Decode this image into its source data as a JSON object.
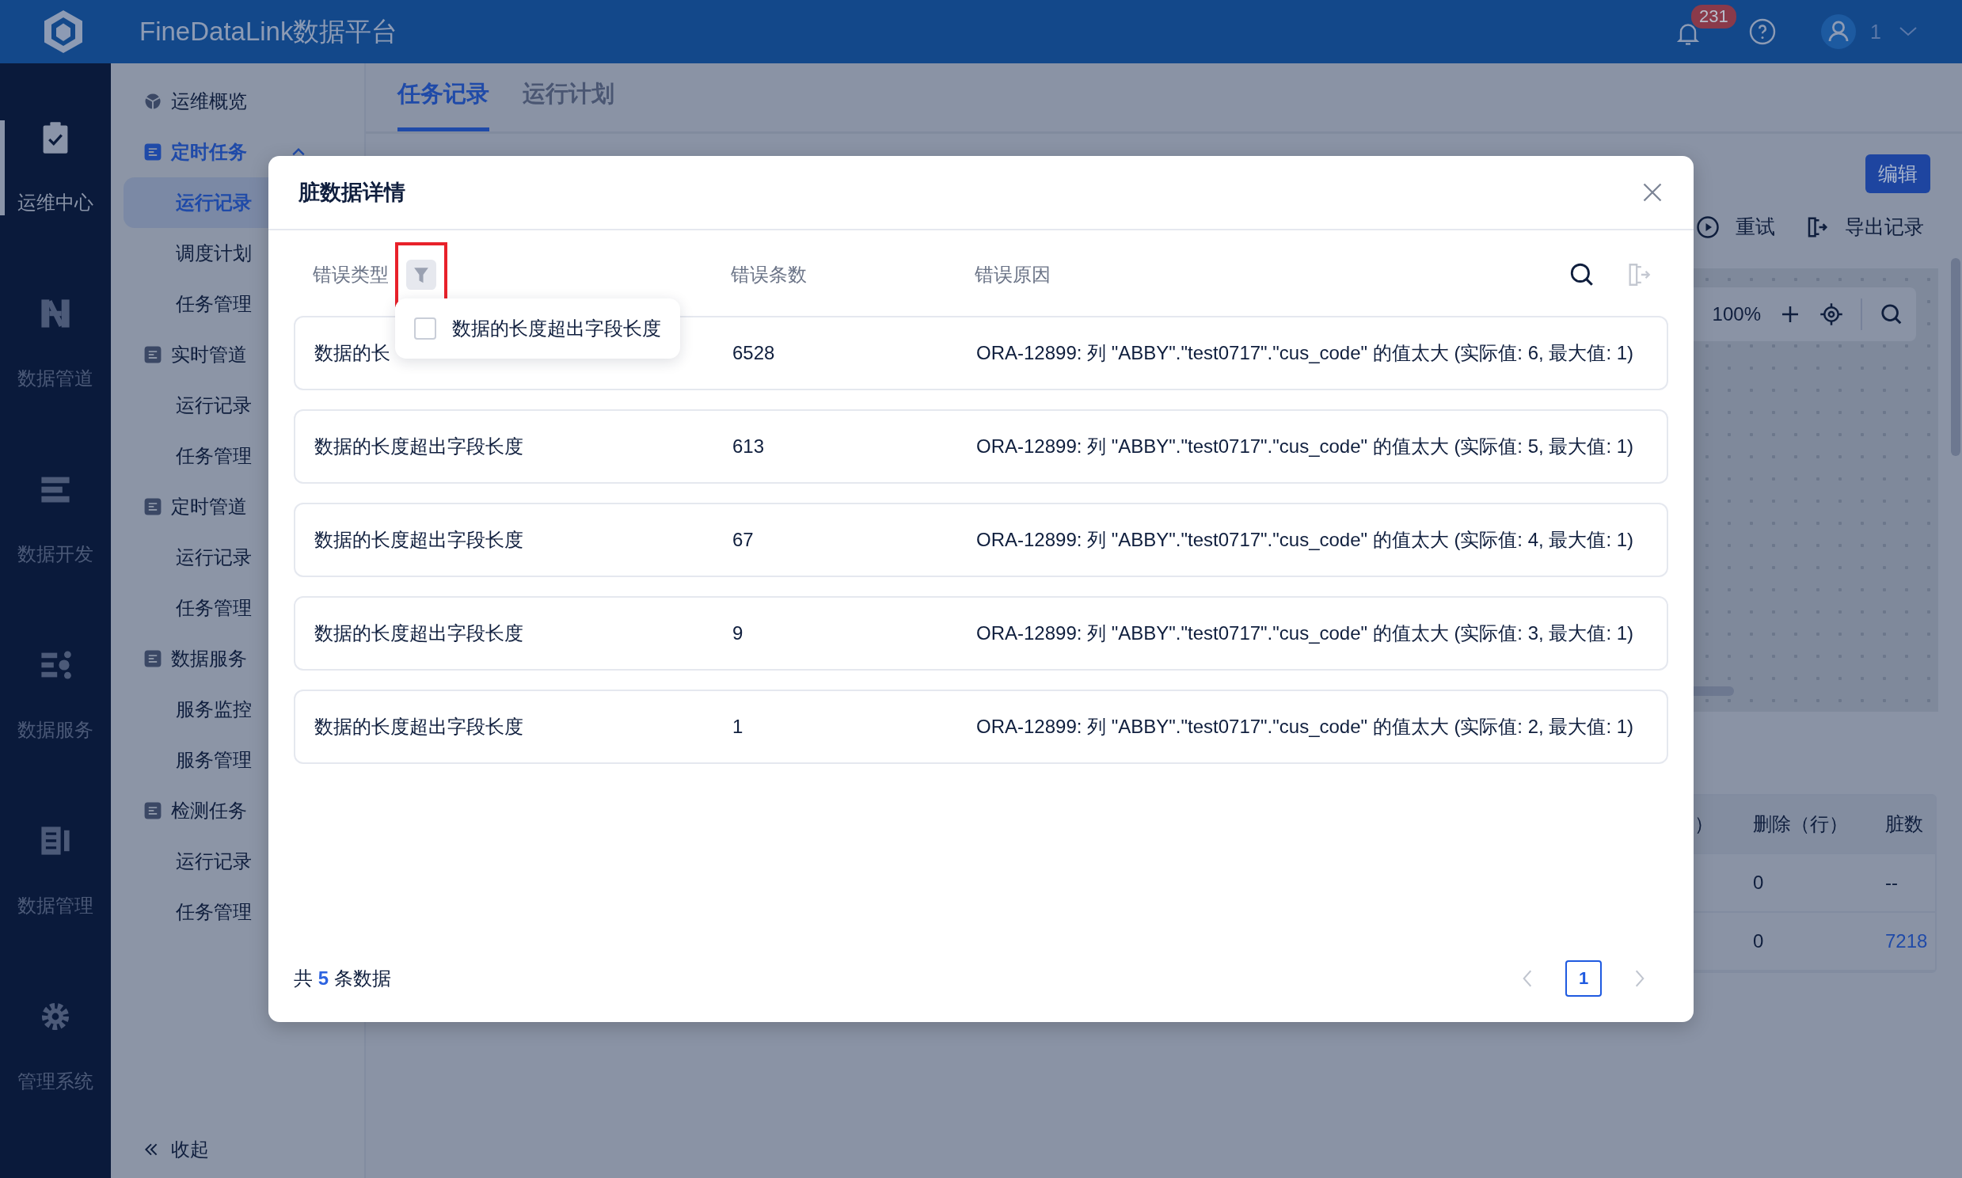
{
  "app": {
    "title": "FineDataLink数据平台",
    "notification_count": "231",
    "user": "1"
  },
  "rail": [
    {
      "label": "运维中心",
      "selected": true
    },
    {
      "label": "数据管道",
      "selected": false
    },
    {
      "label": "数据开发",
      "selected": false
    },
    {
      "label": "数据服务",
      "selected": false
    },
    {
      "label": "数据管理",
      "selected": false
    },
    {
      "label": "管理系统",
      "selected": false
    }
  ],
  "sidebar": {
    "items": [
      {
        "label": "运维概览",
        "active": false
      },
      {
        "label": "定时任务",
        "active": true,
        "children": [
          {
            "label": "运行记录",
            "selected": true
          },
          {
            "label": "调度计划",
            "selected": false
          },
          {
            "label": "任务管理",
            "selected": false
          }
        ]
      },
      {
        "label": "实时管道",
        "active": false,
        "children": [
          {
            "label": "运行记录",
            "selected": false
          },
          {
            "label": "任务管理",
            "selected": false
          }
        ]
      },
      {
        "label": "定时管道",
        "active": false,
        "children": [
          {
            "label": "运行记录",
            "selected": false
          },
          {
            "label": "任务管理",
            "selected": false
          }
        ]
      },
      {
        "label": "数据服务",
        "active": false,
        "children": [
          {
            "label": "服务监控",
            "selected": false
          },
          {
            "label": "服务管理",
            "selected": false
          }
        ]
      },
      {
        "label": "检测任务",
        "active": false,
        "children": [
          {
            "label": "运行记录",
            "selected": false
          },
          {
            "label": "任务管理",
            "selected": false
          }
        ]
      }
    ],
    "collapse": "收起"
  },
  "main": {
    "tabs": [
      {
        "label": "任务记录",
        "selected": true
      },
      {
        "label": "运行计划",
        "selected": false
      }
    ],
    "edit_button": "编辑",
    "actions": [
      "重试",
      "导出记录"
    ],
    "zoom": "100%",
    "table": {
      "columns": [
        "）",
        "删除（行）",
        "脏数"
      ],
      "rows": [
        {
          "deleted": "0",
          "dirty": "--",
          "dirty_is_link": false
        },
        {
          "deleted": "0",
          "dirty": "7218",
          "dirty_is_link": true
        }
      ]
    }
  },
  "modal": {
    "title": "脏数据详情",
    "columns": [
      "错误类型",
      "错误条数",
      "错误原因"
    ],
    "filter_options": [
      {
        "label": "数据的长度超出字段长度",
        "checked": false
      }
    ],
    "rows": [
      {
        "type": "数据的长",
        "count": "6528",
        "reason": "ORA-12899: 列 \"ABBY\".\"test0717\".\"cus_code\" 的值太大 (实际值: 6, 最大值: 1)"
      },
      {
        "type": "数据的长度超出字段长度",
        "count": "613",
        "reason": "ORA-12899: 列 \"ABBY\".\"test0717\".\"cus_code\" 的值太大 (实际值: 5, 最大值: 1)"
      },
      {
        "type": "数据的长度超出字段长度",
        "count": "67",
        "reason": "ORA-12899: 列 \"ABBY\".\"test0717\".\"cus_code\" 的值太大 (实际值: 4, 最大值: 1)"
      },
      {
        "type": "数据的长度超出字段长度",
        "count": "9",
        "reason": "ORA-12899: 列 \"ABBY\".\"test0717\".\"cus_code\" 的值太大 (实际值: 3, 最大值: 1)"
      },
      {
        "type": "数据的长度超出字段长度",
        "count": "1",
        "reason": "ORA-12899: 列 \"ABBY\".\"test0717\".\"cus_code\" 的值太大 (实际值: 2, 最大值: 1)"
      }
    ],
    "total": "共 **5** 条数据",
    "pages": [
      {
        "label": "1",
        "selected": true
      }
    ]
  }
}
